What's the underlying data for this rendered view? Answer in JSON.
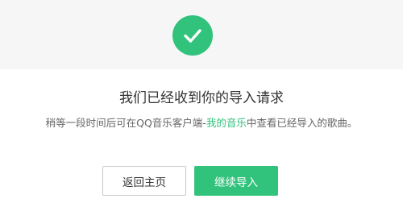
{
  "status": {
    "icon": "check-icon",
    "accent_color": "#31c27c"
  },
  "headline": "我们已经收到你的导入请求",
  "description": {
    "before_link": "稍等一段时间后可在QQ音乐客户端-",
    "link_text": "我的音乐",
    "after_link": "中查看已经导入的歌曲。"
  },
  "actions": {
    "home_label": "返回主页",
    "continue_label": "继续导入"
  }
}
